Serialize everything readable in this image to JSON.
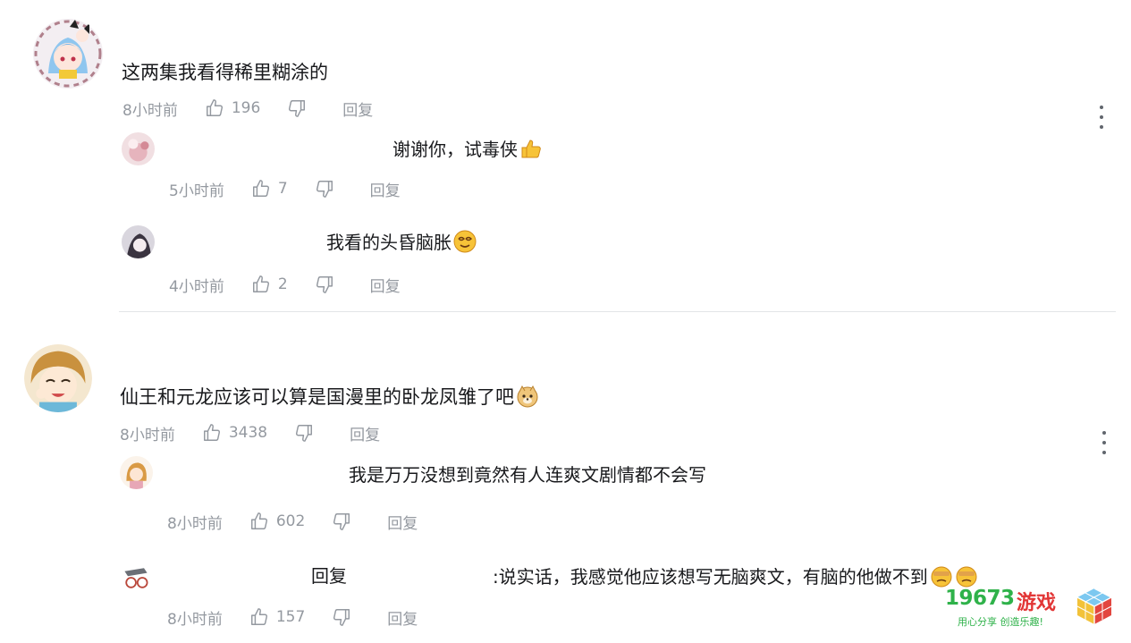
{
  "threads": [
    {
      "comment": {
        "text": "这两集我看得稀里糊涂的",
        "time": "8小时前",
        "likes": "196",
        "reply_label": "回复",
        "emoji": ""
      },
      "replies": [
        {
          "text": "谢谢你，试毒侠",
          "emoji": "thumbs-up-emoji",
          "time": "5小时前",
          "likes": "7",
          "reply_label": "回复"
        },
        {
          "text": "我看的头昏脑胀",
          "emoji": "dizzy-face-emoji",
          "time": "4小时前",
          "likes": "2",
          "reply_label": "回复"
        }
      ]
    },
    {
      "comment": {
        "text": "仙王和元龙应该可以算是国漫里的卧龙凤雏了吧",
        "time": "8小时前",
        "likes": "3438",
        "reply_label": "回复",
        "emoji": "doge-emoji"
      },
      "replies": [
        {
          "text": "我是万万没想到竟然有人连爽文剧情都不会写",
          "emoji": "",
          "time": "8小时前",
          "likes": "602",
          "reply_label": "回复"
        },
        {
          "prefix": "回复",
          "text": ":说实话，我感觉他应该想写无脑爽文，有脑的他做不到",
          "emoji": "facepalm-emoji",
          "time": "8小时前",
          "likes": "157",
          "reply_label": "回复"
        }
      ]
    }
  ],
  "watermark": {
    "number": "19673",
    "name": "游戏",
    "slogan": "用心分享 创造乐趣!"
  },
  "colors": {
    "text": "#18191c",
    "meta": "#9499a0",
    "divider": "#e3e5e7",
    "watermark_green": "#2fb24a",
    "watermark_red": "#e23636"
  },
  "icons": [
    "thumbs-up-outline-icon",
    "thumbs-down-outline-icon",
    "more-vertical-icon"
  ]
}
